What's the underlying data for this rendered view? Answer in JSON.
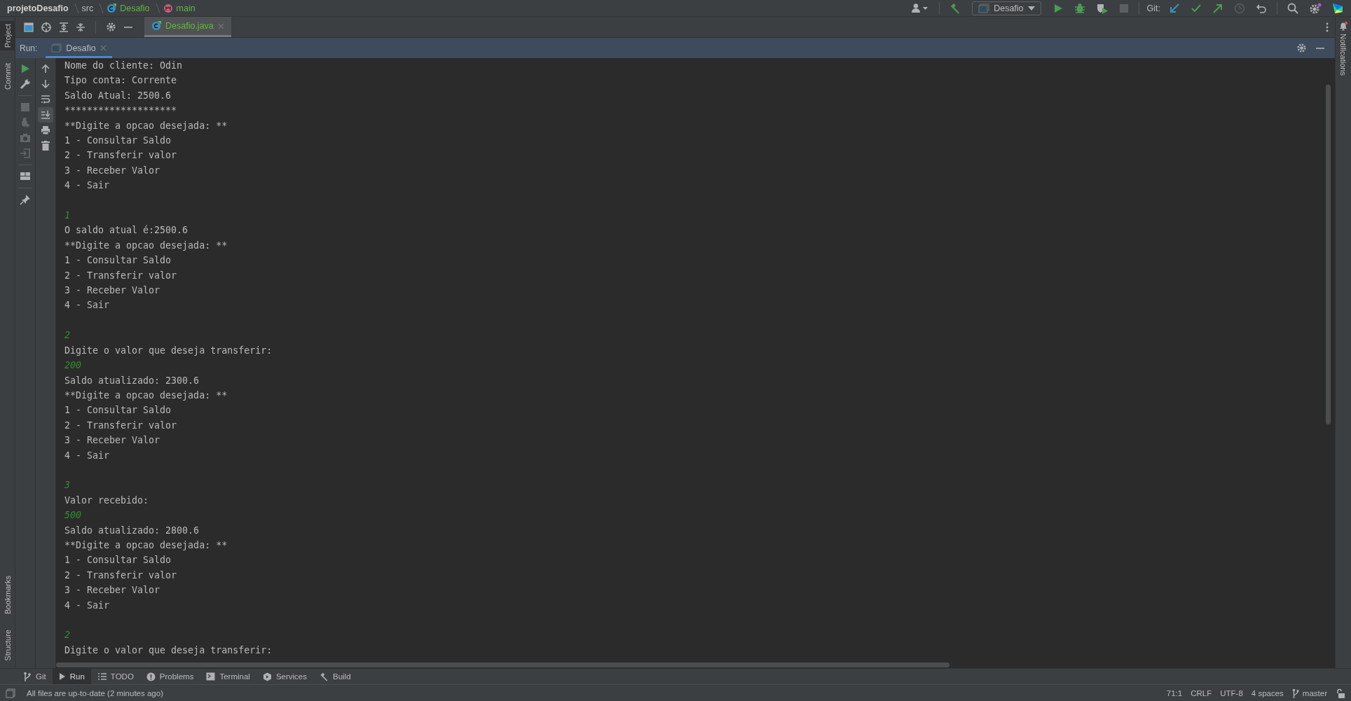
{
  "breadcrumb": [
    {
      "label": "projetoDesafio",
      "kind": "project"
    },
    {
      "label": "src",
      "kind": "folder"
    },
    {
      "label": "Desafio",
      "kind": "class"
    },
    {
      "label": "main",
      "kind": "method"
    }
  ],
  "toolbar": {
    "run_config": "Desafio",
    "git_label": "Git:"
  },
  "left_strip": {
    "top": [
      {
        "label": "Project",
        "selected": true
      },
      {
        "label": "Commit",
        "selected": false
      }
    ],
    "bottom": [
      {
        "label": "Bookmarks",
        "selected": false
      },
      {
        "label": "Structure",
        "selected": false
      }
    ]
  },
  "right_strip": {
    "label": "Notifications"
  },
  "editor_tab": {
    "label": "Desafio.java"
  },
  "run_panel": {
    "label": "Run:",
    "tab": "Desafio",
    "primary_tools": [
      {
        "disabled": false
      },
      {
        "disabled": false
      },
      {
        "disabled": true
      },
      {
        "disabled": true
      },
      {
        "disabled": true
      },
      {
        "disabled": true
      },
      {
        "disabled": false
      },
      {
        "disabled": false
      }
    ],
    "secondary_tools": [
      {
        "on": false
      },
      {
        "on": false
      },
      {
        "on": false
      },
      {
        "on": true
      },
      {
        "on": false
      },
      {
        "on": false
      }
    ]
  },
  "console": [
    {
      "text": "Nome do cliente: Odin",
      "kind": "output"
    },
    {
      "text": "Tipo conta: Corrente",
      "kind": "output"
    },
    {
      "text": "Saldo Atual: 2500.6",
      "kind": "output"
    },
    {
      "text": "********************",
      "kind": "output"
    },
    {
      "text": "**Digite a opcao desejada: **",
      "kind": "output"
    },
    {
      "text": "1 - Consultar Saldo",
      "kind": "output"
    },
    {
      "text": "2 - Transferir valor",
      "kind": "output"
    },
    {
      "text": "3 - Receber Valor",
      "kind": "output"
    },
    {
      "text": "4 - Sair",
      "kind": "output"
    },
    {
      "text": "1",
      "kind": "input",
      "blank_before": true
    },
    {
      "text": "O saldo atual é:2500.6",
      "kind": "output"
    },
    {
      "text": "**Digite a opcao desejada: **",
      "kind": "output"
    },
    {
      "text": "1 - Consultar Saldo",
      "kind": "output"
    },
    {
      "text": "2 - Transferir valor",
      "kind": "output"
    },
    {
      "text": "3 - Receber Valor",
      "kind": "output"
    },
    {
      "text": "4 - Sair",
      "kind": "output"
    },
    {
      "text": "2",
      "kind": "input",
      "blank_before": true
    },
    {
      "text": "Digite o valor que deseja transferir:",
      "kind": "output"
    },
    {
      "text": "200",
      "kind": "input"
    },
    {
      "text": "Saldo atualizado: 2300.6",
      "kind": "output"
    },
    {
      "text": "**Digite a opcao desejada: **",
      "kind": "output"
    },
    {
      "text": "1 - Consultar Saldo",
      "kind": "output"
    },
    {
      "text": "2 - Transferir valor",
      "kind": "output"
    },
    {
      "text": "3 - Receber Valor",
      "kind": "output"
    },
    {
      "text": "4 - Sair",
      "kind": "output"
    },
    {
      "text": "3",
      "kind": "input",
      "blank_before": true
    },
    {
      "text": "Valor recebido:",
      "kind": "output"
    },
    {
      "text": "500",
      "kind": "input"
    },
    {
      "text": "Saldo atualizado: 2800.6",
      "kind": "output"
    },
    {
      "text": "**Digite a opcao desejada: **",
      "kind": "output"
    },
    {
      "text": "1 - Consultar Saldo",
      "kind": "output"
    },
    {
      "text": "2 - Transferir valor",
      "kind": "output"
    },
    {
      "text": "3 - Receber Valor",
      "kind": "output"
    },
    {
      "text": "4 - Sair",
      "kind": "output"
    },
    {
      "text": "2",
      "kind": "input",
      "blank_before": true
    },
    {
      "text": "Digite o valor que deseja transferir:",
      "kind": "output"
    }
  ],
  "bottom_tabs": [
    {
      "label": "Git",
      "selected": false
    },
    {
      "label": "Run",
      "selected": true
    },
    {
      "label": "TODO",
      "selected": false
    },
    {
      "label": "Problems",
      "selected": false
    },
    {
      "label": "Terminal",
      "selected": false
    },
    {
      "label": "Services",
      "selected": false
    },
    {
      "label": "Build",
      "selected": false
    }
  ],
  "status_bar": {
    "message": "All files are up-to-date (2 minutes ago)",
    "position": "71:1",
    "line_separator": "CRLF",
    "encoding": "UTF-8",
    "indent": "4 spaces",
    "branch": "master"
  }
}
